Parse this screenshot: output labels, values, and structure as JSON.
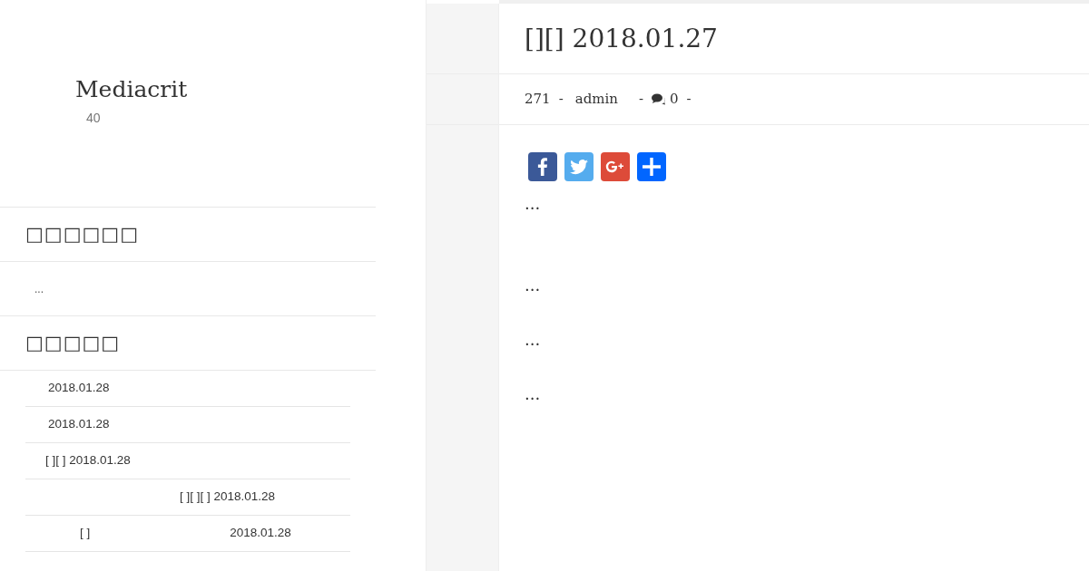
{
  "site": {
    "title": "Mediacrit",
    "tagline": "40"
  },
  "widgets": [
    {
      "kind": "text",
      "heading": "□□□□□□",
      "text": "..."
    },
    {
      "kind": "posts",
      "heading": "□□□□□",
      "rows": [
        {
          "texts": [
            "2018.01.28"
          ]
        },
        {
          "texts": [
            "2018.01.28"
          ]
        },
        {
          "texts": [
            "[ ][ ] 2018.01.28"
          ]
        },
        {
          "texts": [
            "[ ][ ][ ] 2018.01.28"
          ]
        },
        {
          "texts": [
            "[ ]",
            "2018.01.28"
          ]
        }
      ]
    }
  ],
  "post": {
    "title": "[][] 2018.01.27",
    "meta": {
      "views": "271",
      "author": "admin",
      "comments": "0",
      "separators": [
        "-",
        "-",
        "-"
      ]
    },
    "share": [
      {
        "kind": "facebook",
        "color": "#3b5998"
      },
      {
        "kind": "twitter",
        "color": "#55acee"
      },
      {
        "kind": "google",
        "color": "#dd4b39"
      },
      {
        "kind": "share",
        "color": "#0166ff"
      }
    ],
    "paragraphs": [
      "...",
      "...",
      "...",
      "..."
    ]
  }
}
